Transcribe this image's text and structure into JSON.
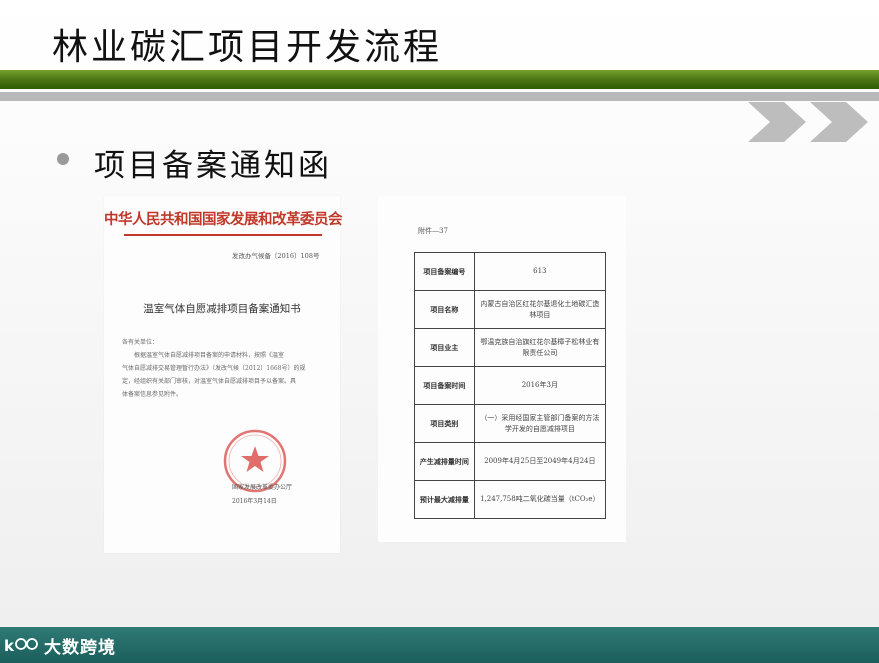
{
  "slide": {
    "title": "林业碳汇项目开发流程",
    "bullet": "项目备案通知函"
  },
  "colors": {
    "accent_green": "#4f7a16",
    "gray_bar": "#b9b9b9",
    "footer_teal": "#1b5e5b",
    "seal_red": "#c0392b"
  },
  "document_left": {
    "header": "中华人民共和国国家发展和改革委员会",
    "doc_number": "发改办气候备〔2016〕108号",
    "title": "温室气体自愿减排项目备案通知书",
    "body_lines": [
      "各有关单位：",
      "　　根据温室气体自愿减排项目备案的申请材料，按照《温室",
      "气体自愿减排交易管理暂行办法》（发改气候〔2012〕1668号）的规",
      "定，经组织有关部门审核，对温室气体自愿减排项目予以备案。具",
      "体备案信息参见附件。"
    ],
    "issuer": "国家发展改革委办公厅",
    "date": "2016年3月14日"
  },
  "document_right": {
    "annex_label": "附件—37",
    "rows": [
      {
        "key": "项目备案编号",
        "value": "613"
      },
      {
        "key": "项目名称",
        "value": "内蒙古自治区红花尔基退化土地碳汇造林项目"
      },
      {
        "key": "项目业主",
        "value": "鄂温克族自治旗红花尔基樟子松林业有限责任公司"
      },
      {
        "key": "项目备案时间",
        "value": "2016年3月"
      },
      {
        "key": "项目类别",
        "value": "（一）采用经国家主管部门备案的方法学开发的自愿减排项目"
      },
      {
        "key": "产生减排量时间",
        "value": "2009年4月25日至2049年4月24日"
      },
      {
        "key": "预计最大减排量",
        "value": "1,247,758吨二氧化碳当量（tCO₂e）"
      }
    ]
  },
  "footer": {
    "brand": "大数跨境",
    "logo_icon": "kejing-logo-icon"
  }
}
